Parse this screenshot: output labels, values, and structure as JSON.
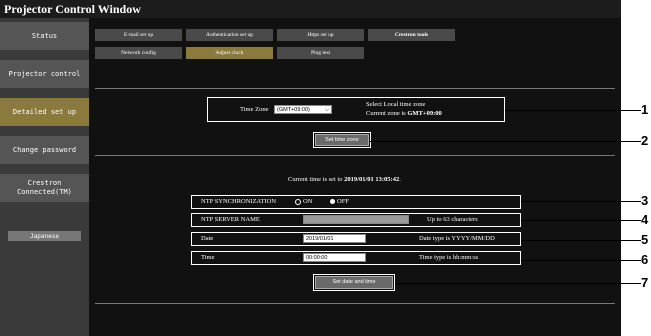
{
  "window": {
    "title": "Projector Control Window"
  },
  "sidebar": {
    "items": [
      {
        "label": "Status"
      },
      {
        "label": "Projector control"
      },
      {
        "label": "Detailed set up"
      },
      {
        "label": "Change password"
      },
      {
        "label": "Crestron Connected(TM)"
      }
    ],
    "language_button": "Japanese"
  },
  "tabs": {
    "row1": [
      "E-mail set up",
      "Authentication set up",
      "Https set up",
      "Crestron tools"
    ],
    "row2": [
      "Network config",
      "Adjust clock",
      "Ping test"
    ]
  },
  "time_zone": {
    "label": "Time Zone",
    "selected": "(GMT+09:00)",
    "hint_line1": "Select Local time zone",
    "hint_prefix": "Current zone is ",
    "current_zone": "GMT+09:00",
    "set_button": "Set time zone"
  },
  "current_time": {
    "prefix": "Current time is set to ",
    "value": "2019/01/01 13:05:42",
    "suffix": "."
  },
  "ntp": {
    "sync_label": "NTP SYNCHRONIZATION",
    "on_label": "ON",
    "off_label": "OFF",
    "selected": "OFF",
    "server_label": "NTP SERVER NAME",
    "server_value": "",
    "server_hint": "Up to 63 characters"
  },
  "date": {
    "label": "Date",
    "value": "2019/01/01",
    "hint": "Date type is YYYY/MM/DD"
  },
  "time": {
    "label": "Time",
    "value": "00:00:00",
    "hint": "Time type is hh:mm:ss"
  },
  "set_date_time_button": "Set date and time",
  "callouts": [
    "1",
    "2",
    "3",
    "4",
    "5",
    "6",
    "7"
  ]
}
